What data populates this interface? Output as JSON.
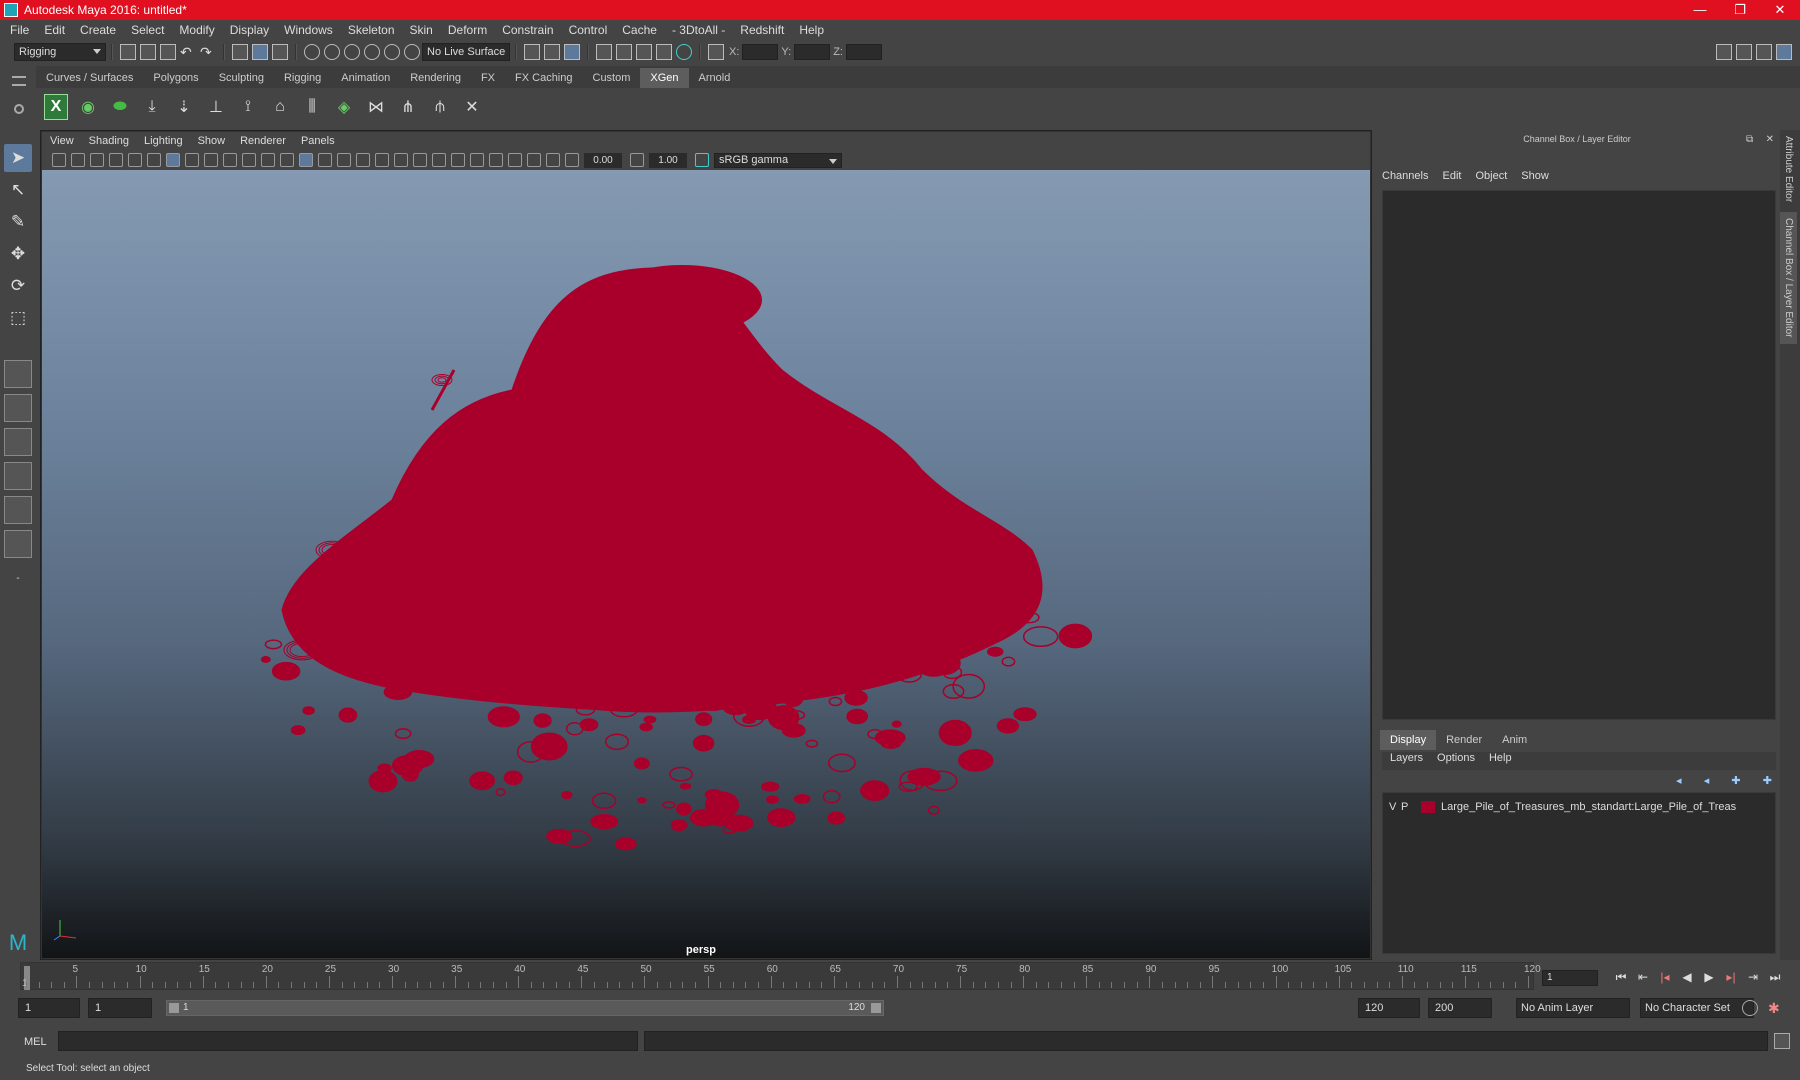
{
  "titlebar": {
    "title": "Autodesk Maya 2016: untitled*",
    "minimize": "—",
    "maximize": "❐",
    "close": "✕"
  },
  "menubar": [
    "File",
    "Edit",
    "Create",
    "Select",
    "Modify",
    "Display",
    "Windows",
    "Skeleton",
    "Skin",
    "Deform",
    "Constrain",
    "Control",
    "Cache",
    "- 3DtoAll -",
    "Redshift",
    "Help"
  ],
  "statusline": {
    "menuset": "Rigging",
    "live_surface": "No Live Surface",
    "x_label": "X:",
    "y_label": "Y:",
    "z_label": "Z:"
  },
  "shelf": {
    "tabs": [
      "Curves / Surfaces",
      "Polygons",
      "Sculpting",
      "Rigging",
      "Animation",
      "Rendering",
      "FX",
      "FX Caching",
      "Custom",
      "XGen",
      "Arnold"
    ],
    "active_tab": "XGen"
  },
  "viewport": {
    "menu": [
      "View",
      "Shading",
      "Lighting",
      "Show",
      "Renderer",
      "Panels"
    ],
    "exposure": "0.00",
    "gamma": "1.00",
    "color_space": "sRGB gamma",
    "camera": "persp",
    "wire_color": "#a8002a"
  },
  "right_panel": {
    "title": "Channel Box / Layer Editor",
    "menu": [
      "Channels",
      "Edit",
      "Object",
      "Show"
    ],
    "side_tabs": [
      "Attribute Editor",
      "Channel Box / Layer Editor"
    ],
    "layer_tabs": [
      "Display",
      "Render",
      "Anim"
    ],
    "active_layer_tab": "Display",
    "layer_menu": [
      "Layers",
      "Options",
      "Help"
    ],
    "layers": [
      {
        "v": "V",
        "p": "P",
        "color": "#a8002a",
        "name": "Large_Pile_of_Treasures_mb_standart:Large_Pile_of_Treas"
      }
    ]
  },
  "timeline": {
    "ticks": [
      "1",
      "5",
      "10",
      "15",
      "20",
      "25",
      "30",
      "35",
      "40",
      "45",
      "50",
      "55",
      "60",
      "65",
      "70",
      "75",
      "80",
      "85",
      "90",
      "95",
      "100",
      "105",
      "110",
      "115",
      "120"
    ],
    "current_frame": "1"
  },
  "range": {
    "start": "1",
    "anim_start": "1",
    "slider_start": "1",
    "slider_end": "120",
    "end": "120",
    "anim_end": "200",
    "anim_layer": "No Anim Layer",
    "character_set": "No Character Set"
  },
  "command": {
    "label": "MEL"
  },
  "help": {
    "text": "Select Tool: select an object"
  }
}
